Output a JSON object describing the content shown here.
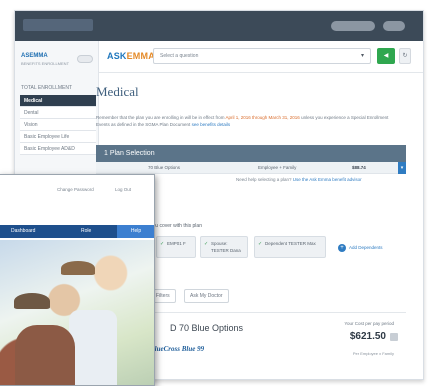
{
  "main_window": {
    "sidebar": {
      "brand": "ASEMMA",
      "brand_sub": "BENEFITS ENROLLMENT",
      "section_header": "TOTAL ENROLLMENT",
      "items": [
        {
          "label": "Medical",
          "active": true
        },
        {
          "label": "Dental",
          "active": false
        },
        {
          "label": "Vision",
          "active": false
        },
        {
          "label": "Basic Employee Life",
          "active": false
        },
        {
          "label": "Basic Employee AD&D",
          "active": false
        }
      ]
    },
    "header": {
      "logo_prefix": "ASK",
      "logo_suffix": "EMMA",
      "question_placeholder": "Select a question",
      "green_button_label": "◀",
      "grey_button_label": "↻"
    },
    "content": {
      "title": "Medical",
      "notice_text_1": "Remember that the plan you are enrolling in will be in effect from ",
      "notice_date_range": "April 1, 2016 through March 31, 2016",
      "notice_text_2": " unless you experience a Special Enrollment Events as defined in the SGMA Plan Document ",
      "notice_link": "see benefits details",
      "plan_section_title": "1   Plan Selection",
      "plan_row": {
        "plan": "70 Blue Options",
        "coverage": "Employee + Family",
        "amount": "$88.74"
      },
      "help_prefix": "Need help selecting a plan? ",
      "help_link": "Use the Ask Emma benefit advisor",
      "coverage_line": "you cover with this plan",
      "dependents": [
        {
          "label": "EMP01 F"
        },
        {
          "label": "Spouse: TESTER Dana"
        },
        {
          "label": "Dependent TESTER Max"
        }
      ],
      "add_dependents": "Add Dependents",
      "filter_buttons": [
        {
          "label": "Filters"
        },
        {
          "label": "Ask My Doctor"
        }
      ],
      "plan_card": {
        "name": "D 70 Blue Options",
        "carrier_logo": "BlueCross Blue 99",
        "cost_label": "Your Cost per pay period",
        "cost_value": "$621.50",
        "cost_sub": "Per Employee x Family"
      }
    }
  },
  "front_window": {
    "top_links": [
      {
        "label": "Change Password"
      },
      {
        "label": "Log Out"
      }
    ],
    "nav": [
      {
        "label": "Dashboard"
      },
      {
        "label": "Role"
      },
      {
        "label": "Help"
      }
    ]
  }
}
